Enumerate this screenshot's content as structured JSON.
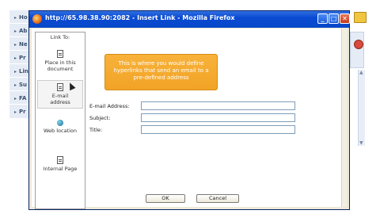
{
  "background": {
    "nav_items": [
      "Ho",
      "Ab",
      "Ne",
      "Pr",
      "Lin",
      "Su",
      "FA",
      "Pr"
    ]
  },
  "window": {
    "title": "http://65.98.38.90:2082 - Insert Link - Mozilla Firefox",
    "buttons": {
      "minimize": "_",
      "maximize": "□",
      "close": "✕"
    }
  },
  "link_to": {
    "label": "Link To:",
    "items": [
      {
        "label_line1": "Place in this",
        "label_line2": "document",
        "icon": "document-icon"
      },
      {
        "label_line1": "E-mail",
        "label_line2": "address",
        "icon": "email-doc-icon"
      },
      {
        "label_line1": "Web location",
        "label_line2": "",
        "icon": "globe-icon"
      },
      {
        "label_line1": "Internal Page",
        "label_line2": "",
        "icon": "page-icon"
      }
    ]
  },
  "tooltip": {
    "line1": "This is where you would define",
    "line2": "hyperlinks that send an email to a",
    "line3": "pre-defined address"
  },
  "form": {
    "email_label": "E-mail Address:",
    "subject_label": "Subject:",
    "title_label": "Title:",
    "email_value": "",
    "subject_value": "",
    "title_value": ""
  },
  "actions": {
    "ok_label": "OK",
    "cancel_label": "Cancel"
  },
  "colors": {
    "titlebar": "#0a4ad3",
    "tooltip": "#f1a326"
  }
}
